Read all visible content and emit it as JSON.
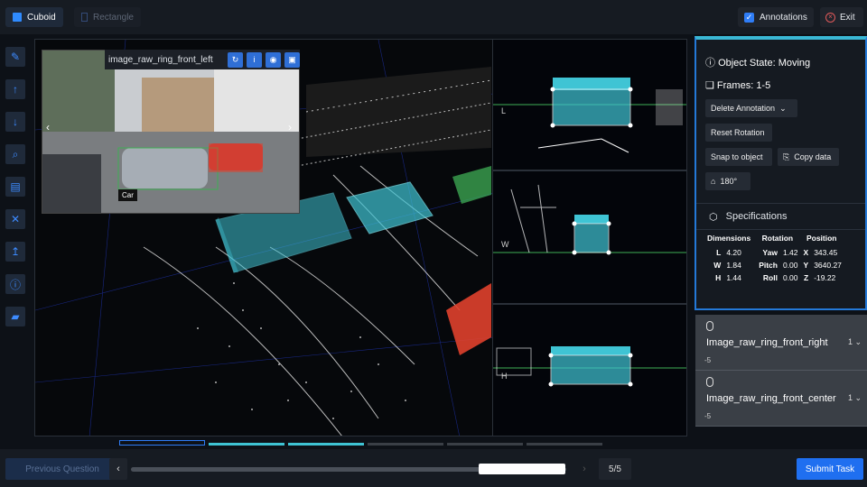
{
  "toolbar": {
    "cuboid_label": "Cuboid",
    "rectangle_label": "Rectangle",
    "annotations_label": "Annotations",
    "exit_label": "Exit"
  },
  "left_tools": [
    "pen-icon",
    "arrow-up-icon",
    "arrow-down-icon",
    "zoom-icon",
    "keyboard-icon",
    "fit-icon",
    "upload-icon",
    "info-icon",
    "book-icon"
  ],
  "camera": {
    "title": "image_raw_ring_front_left",
    "car_tag": "Car"
  },
  "side_views": {
    "top_label": "L",
    "mid_label": "W",
    "bottom_label": "H"
  },
  "panel": {
    "object_state": "Object State: Moving",
    "frames": "Frames: 1-5",
    "delete_label": "Delete Annotation",
    "reset_label": "Reset Rotation",
    "snap_label": "Snap to object",
    "copy_label": "Copy data",
    "rotate_label": "180°",
    "specs_label": "Specifications",
    "headers": [
      "Dimensions",
      "Rotation",
      "Position"
    ],
    "rows": [
      {
        "dk": "L",
        "dv": "4.20",
        "rk": "Yaw",
        "rv": "1.42",
        "pk": "X",
        "pv": "343.45"
      },
      {
        "dk": "W",
        "dv": "1.84",
        "rk": "Pitch",
        "rv": "0.00",
        "pk": "Y",
        "pv": "3640.27"
      },
      {
        "dk": "H",
        "dv": "1.44",
        "rk": "Roll",
        "rv": "0.00",
        "pk": "Z",
        "pv": "-19.22"
      }
    ]
  },
  "camera_list": [
    {
      "name": "Image_raw_ring_front_right",
      "num": "1",
      "sub": "-5"
    },
    {
      "name": "Image_raw_ring_front_center",
      "num": "1",
      "sub": "-5"
    }
  ],
  "bottom": {
    "previous_label": "Previous Question",
    "pager": "5/5",
    "submit_label": "Submit Task",
    "progress": 0.82
  },
  "colors": {
    "accent": "#2f7df6",
    "box_cyan": "#3fc4d4",
    "box_red": "#e0412c",
    "box_green": "#3fae55"
  }
}
